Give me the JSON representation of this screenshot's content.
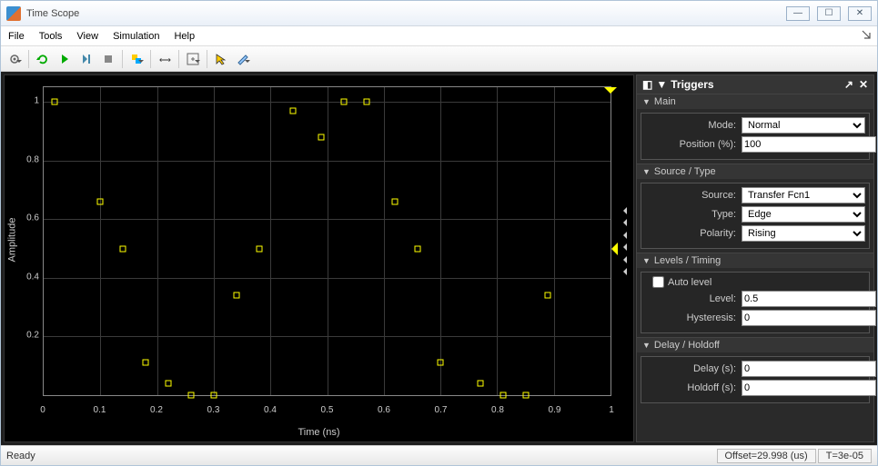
{
  "window": {
    "title": "Time Scope"
  },
  "menu": {
    "items": [
      "File",
      "Tools",
      "View",
      "Simulation",
      "Help"
    ]
  },
  "toolbar": {
    "buttons": [
      {
        "name": "settings-icon",
        "dd": true
      },
      {
        "sep": true
      },
      {
        "name": "restart-icon"
      },
      {
        "name": "play-icon"
      },
      {
        "name": "step-icon"
      },
      {
        "name": "stop-icon"
      },
      {
        "sep": true
      },
      {
        "name": "highlight-icon",
        "dd": true
      },
      {
        "sep": true
      },
      {
        "name": "find-icon"
      },
      {
        "sep": true
      },
      {
        "name": "zoom-in-icon",
        "dd": true
      },
      {
        "sep": true
      },
      {
        "name": "cursor-icon"
      },
      {
        "name": "annotate-icon",
        "dd": true
      }
    ]
  },
  "chart_data": {
    "type": "scatter",
    "xlabel": "Time (ns)",
    "ylabel": "Amplitude",
    "xlim": [
      0,
      1
    ],
    "ylim": [
      0,
      1.05
    ],
    "xticks": [
      0,
      0.1,
      0.2,
      0.3,
      0.4,
      0.5,
      0.6,
      0.7,
      0.8,
      0.9,
      1
    ],
    "yticks": [
      0.2,
      0.4,
      0.6,
      0.8,
      1
    ],
    "points": [
      {
        "x": 0.02,
        "y": 1.0
      },
      {
        "x": 0.1,
        "y": 0.66
      },
      {
        "x": 0.14,
        "y": 0.5
      },
      {
        "x": 0.18,
        "y": 0.11
      },
      {
        "x": 0.22,
        "y": 0.04
      },
      {
        "x": 0.26,
        "y": 0.0
      },
      {
        "x": 0.3,
        "y": 0.0
      },
      {
        "x": 0.34,
        "y": 0.34
      },
      {
        "x": 0.38,
        "y": 0.5
      },
      {
        "x": 0.44,
        "y": 0.97
      },
      {
        "x": 0.49,
        "y": 0.88
      },
      {
        "x": 0.53,
        "y": 1.0
      },
      {
        "x": 0.57,
        "y": 1.0
      },
      {
        "x": 0.62,
        "y": 0.66
      },
      {
        "x": 0.66,
        "y": 0.5
      },
      {
        "x": 0.7,
        "y": 0.11
      },
      {
        "x": 0.77,
        "y": 0.04
      },
      {
        "x": 0.81,
        "y": 0.0
      },
      {
        "x": 0.85,
        "y": 0.0
      },
      {
        "x": 0.89,
        "y": 0.34
      }
    ],
    "trigger_marker_top_x": 1.0,
    "trigger_marker_right_y": 0.5
  },
  "triggers_panel": {
    "title": "Triggers",
    "main": {
      "header": "Main",
      "mode_label": "Mode:",
      "mode_value": "Normal",
      "position_label": "Position (%):",
      "position_value": "100"
    },
    "source": {
      "header": "Source / Type",
      "source_label": "Source:",
      "source_value": "Transfer Fcn1",
      "type_label": "Type:",
      "type_value": "Edge",
      "polarity_label": "Polarity:",
      "polarity_value": "Rising"
    },
    "levels": {
      "header": "Levels / Timing",
      "auto_label": "Auto level",
      "auto_checked": false,
      "level_label": "Level:",
      "level_value": "0.5",
      "hyst_label": "Hysteresis:",
      "hyst_value": "0"
    },
    "delay": {
      "header": "Delay / Holdoff",
      "delay_label": "Delay (s):",
      "delay_value": "0",
      "holdoff_label": "Holdoff (s):",
      "holdoff_value": "0"
    }
  },
  "status": {
    "ready": "Ready",
    "offset": "Offset=29.998 (us)",
    "t": "T=3e-05"
  }
}
